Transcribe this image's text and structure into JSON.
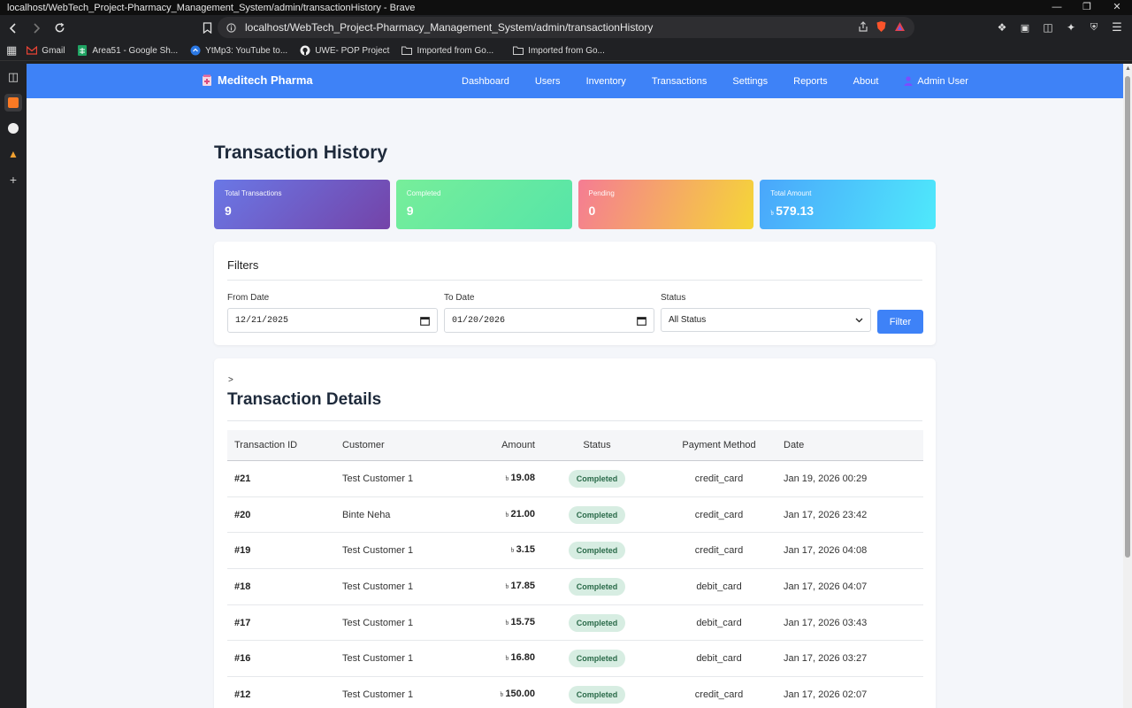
{
  "browser": {
    "window_title": "localhost/WebTech_Project-Pharmacy_Management_System/admin/transactionHistory - Brave",
    "url": "localhost/WebTech_Project-Pharmacy_Management_System/admin/transactionHistory",
    "bookmarks": [
      {
        "label": "Gmail",
        "icon": "gmail-icon"
      },
      {
        "label": "Area51 - Google Sh...",
        "icon": "sheets-icon"
      },
      {
        "label": "YtMp3: YouTube to...",
        "icon": "ytmp3-icon"
      },
      {
        "label": "UWE- POP Project",
        "icon": "github-icon"
      },
      {
        "label": "Imported from Go...",
        "icon": "folder-icon"
      },
      {
        "label": "Imported from Go...",
        "icon": "folder-icon"
      }
    ]
  },
  "navbar": {
    "brand": "Meditech Pharma",
    "links": [
      "Dashboard",
      "Users",
      "Inventory",
      "Transactions",
      "Settings",
      "Reports",
      "About"
    ],
    "user": "Admin User",
    "color": "#3e82f7"
  },
  "page": {
    "title": "Transaction History"
  },
  "stats": [
    {
      "label": "Total Transactions",
      "value": "9"
    },
    {
      "label": "Completed",
      "value": "9"
    },
    {
      "label": "Pending",
      "value": "0"
    },
    {
      "label": "Total Amount",
      "symbol": "৳",
      "value": "579.13"
    }
  ],
  "filters": {
    "title": "Filters",
    "from_label": "From Date",
    "from_value": "12/21/2025",
    "to_label": "To Date",
    "to_value": "01/20/2026",
    "status_label": "Status",
    "status_value": "All Status",
    "button": "Filter"
  },
  "details": {
    "caret": ">",
    "title": "Transaction Details",
    "headers": [
      "Transaction ID",
      "Customer",
      "Amount",
      "Status",
      "Payment Method",
      "Date"
    ],
    "currency_symbol": "৳",
    "rows": [
      {
        "id": "#21",
        "customer": "Test Customer 1",
        "amount": "19.08",
        "status": "Completed",
        "method": "credit_card",
        "date": "Jan 19, 2026 00:29"
      },
      {
        "id": "#20",
        "customer": "Binte Neha",
        "amount": "21.00",
        "status": "Completed",
        "method": "credit_card",
        "date": "Jan 17, 2026 23:42"
      },
      {
        "id": "#19",
        "customer": "Test Customer 1",
        "amount": "3.15",
        "status": "Completed",
        "method": "credit_card",
        "date": "Jan 17, 2026 04:08"
      },
      {
        "id": "#18",
        "customer": "Test Customer 1",
        "amount": "17.85",
        "status": "Completed",
        "method": "debit_card",
        "date": "Jan 17, 2026 04:07"
      },
      {
        "id": "#17",
        "customer": "Test Customer 1",
        "amount": "15.75",
        "status": "Completed",
        "method": "debit_card",
        "date": "Jan 17, 2026 03:43"
      },
      {
        "id": "#16",
        "customer": "Test Customer 1",
        "amount": "16.80",
        "status": "Completed",
        "method": "debit_card",
        "date": "Jan 17, 2026 03:27"
      },
      {
        "id": "#12",
        "customer": "Test Customer 1",
        "amount": "150.00",
        "status": "Completed",
        "method": "credit_card",
        "date": "Jan 17, 2026 02:07"
      }
    ]
  }
}
